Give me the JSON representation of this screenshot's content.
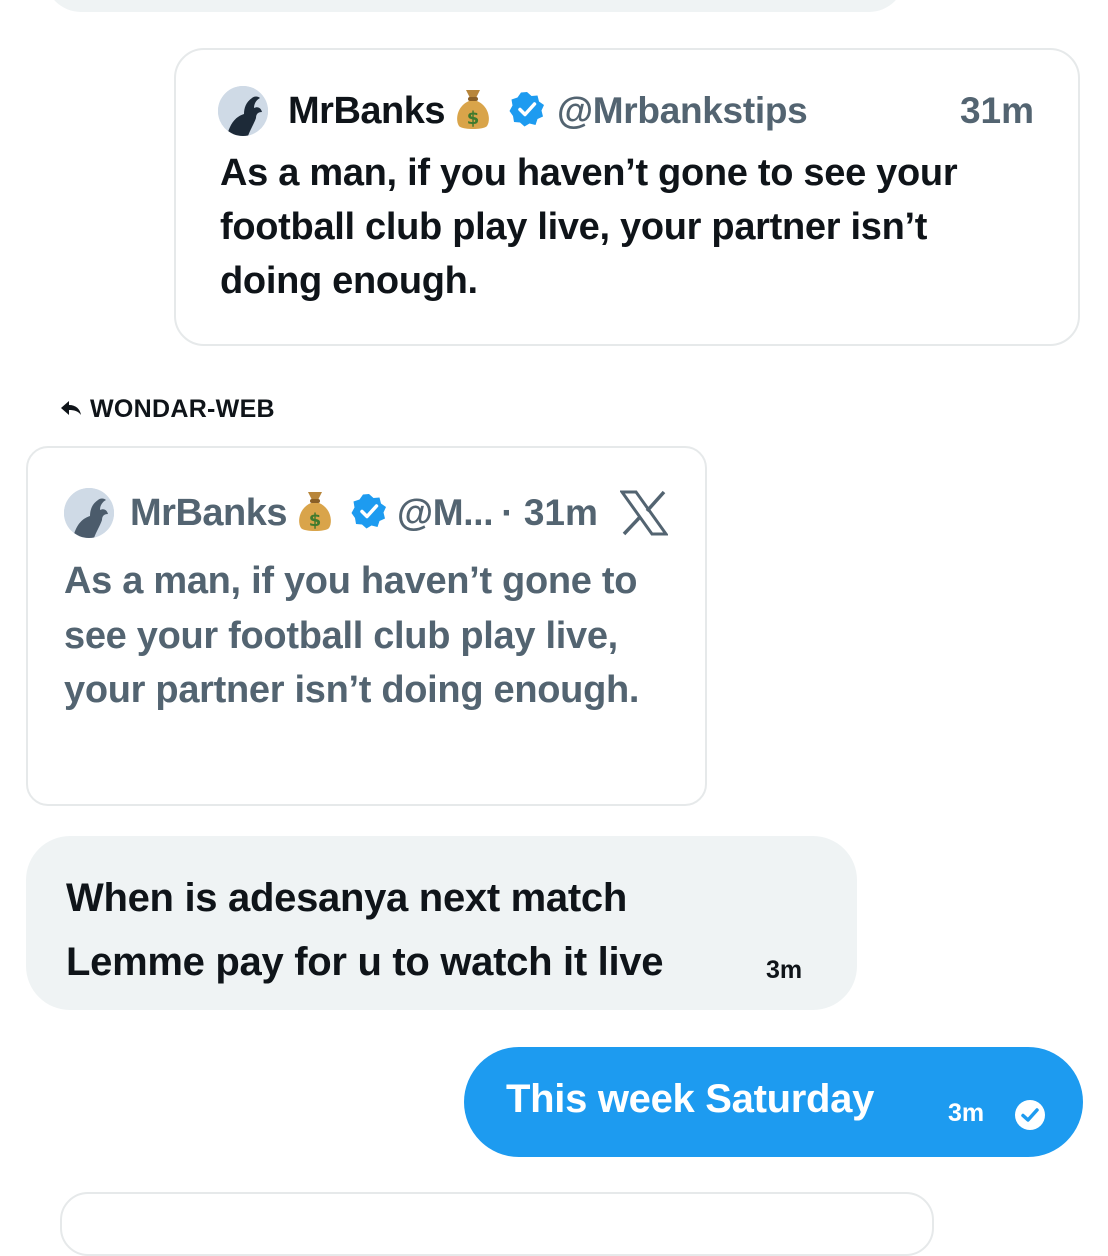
{
  "colors": {
    "accent": "#1d9bf0",
    "text_primary": "#0f1419",
    "text_secondary": "#536471",
    "bubble_bg": "#eff3f4",
    "border": "#e6e9ea"
  },
  "quoted_post": {
    "author_name": "MrBanks",
    "name_emoji": "money-bag-icon",
    "verified": "verified-badge-icon",
    "handle": "@Mrbankstips",
    "time": "31m",
    "text": "As a man, if you haven’t gone to see your football club play live, your partner isn’t doing enough."
  },
  "reply_label": {
    "icon": "reply-arrow-icon",
    "text": "WONDAR-WEB"
  },
  "embedded_post": {
    "author_name": "MrBanks",
    "handle": "@M...",
    "time": "· 31m",
    "source_icon": "x-logo-icon",
    "text": "As a man, if you haven’t gone to see your football club play live, your partner isn’t doing enough."
  },
  "messages": {
    "received": {
      "line1": "When is adesanya next match",
      "line2": "Lemme pay for u to watch it live",
      "time": "3m"
    },
    "sent": {
      "text": "This week Saturday",
      "time": "3m",
      "status_icon": "sent-check-icon"
    }
  }
}
